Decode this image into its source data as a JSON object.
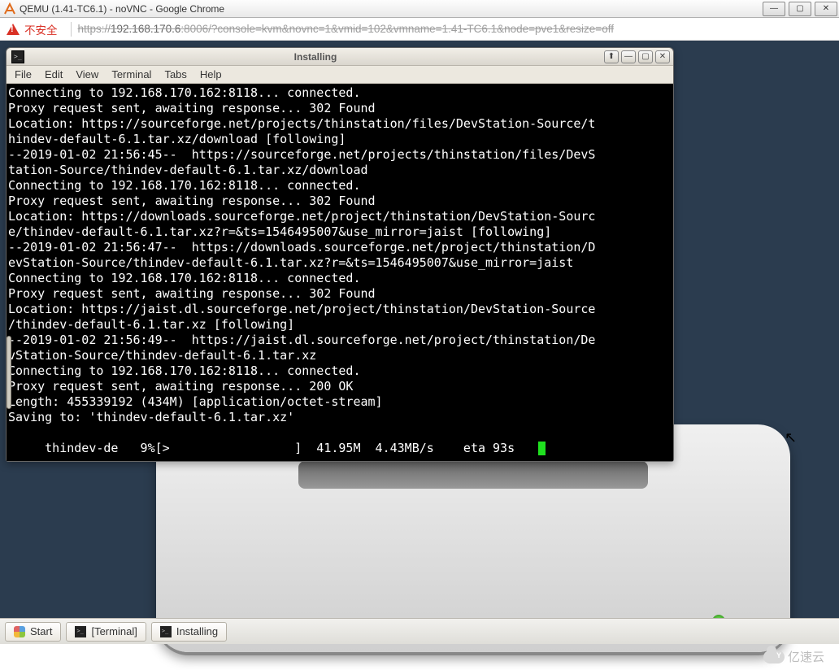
{
  "chrome": {
    "title": "QEMU (1.41-TC6.1) - noVNC - Google Chrome",
    "insecure_label": "不安全",
    "url_prefix": "https://",
    "url_host": "192.168.170.6",
    "url_rest": ":8006/?console=kvm&novnc=1&vmid=102&vmname=1.41-TC6.1&node=pve1&resize=off"
  },
  "term": {
    "title": "Installing",
    "menus": [
      "File",
      "Edit",
      "View",
      "Terminal",
      "Tabs",
      "Help"
    ],
    "lines": [
      "Connecting to 192.168.170.162:8118... connected.",
      "Proxy request sent, awaiting response... 302 Found",
      "Location: https://sourceforge.net/projects/thinstation/files/DevStation-Source/t",
      "hindev-default-6.1.tar.xz/download [following]",
      "--2019-01-02 21:56:45--  https://sourceforge.net/projects/thinstation/files/DevS",
      "tation-Source/thindev-default-6.1.tar.xz/download",
      "Connecting to 192.168.170.162:8118... connected.",
      "Proxy request sent, awaiting response... 302 Found",
      "Location: https://downloads.sourceforge.net/project/thinstation/DevStation-Sourc",
      "e/thindev-default-6.1.tar.xz?r=&ts=1546495007&use_mirror=jaist [following]",
      "--2019-01-02 21:56:47--  https://downloads.sourceforge.net/project/thinstation/D",
      "evStation-Source/thindev-default-6.1.tar.xz?r=&ts=1546495007&use_mirror=jaist",
      "Connecting to 192.168.170.162:8118... connected.",
      "Proxy request sent, awaiting response... 302 Found",
      "Location: https://jaist.dl.sourceforge.net/project/thinstation/DevStation-Source",
      "/thindev-default-6.1.tar.xz [following]",
      "--2019-01-02 21:56:49--  https://jaist.dl.sourceforge.net/project/thinstation/De",
      "vStation-Source/thindev-default-6.1.tar.xz",
      "Connecting to 192.168.170.162:8118... connected.",
      "Proxy request sent, awaiting response... 200 OK",
      "Length: 455339192 (434M) [application/octet-stream]",
      "Saving to: 'thindev-default-6.1.tar.xz'",
      "",
      "     thindev-de   9%[>                 ]  41.95M  4.43MB/s    eta 93s   "
    ],
    "progress": {
      "file": "thindev-de",
      "percent": "9%",
      "downloaded": "41.95M",
      "speed": "4.43MB/s",
      "eta": "eta 93s"
    }
  },
  "taskbar": {
    "start": "Start",
    "items": [
      "[Terminal]",
      "Installing"
    ]
  },
  "watermark": "亿速云"
}
